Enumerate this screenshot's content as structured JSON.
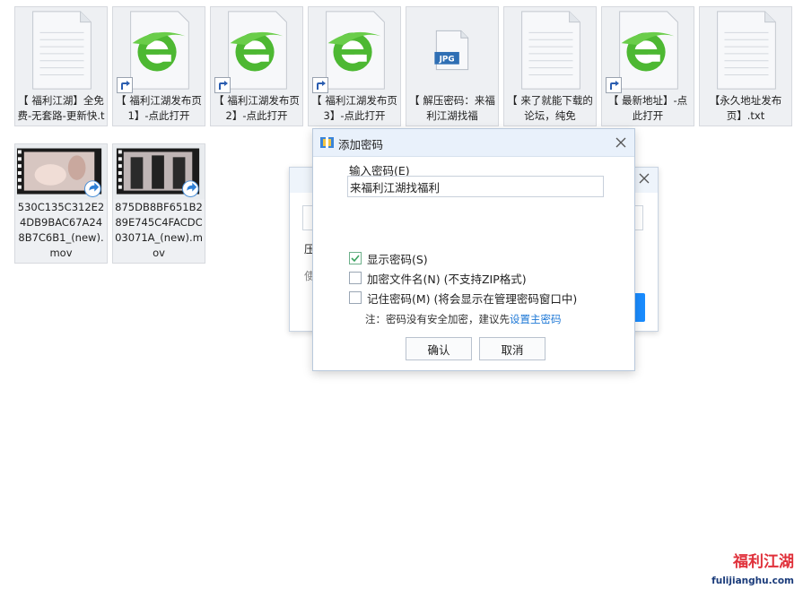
{
  "files": [
    {
      "label": "【 福利江湖】全免费-无套路-更新快.txt",
      "type": "txt",
      "shortcut": false
    },
    {
      "label": "【 福利江湖发布页1】-点此打开",
      "type": "ie",
      "shortcut": true
    },
    {
      "label": "【 福利江湖发布页2】-点此打开",
      "type": "ie",
      "shortcut": true
    },
    {
      "label": "【 福利江湖发布页3】-点此打开",
      "type": "ie",
      "shortcut": true
    },
    {
      "label": "【 解压密码：来福利江湖找福",
      "type": "jpg",
      "shortcut": false,
      "badge": "JPG"
    },
    {
      "label": "【 来了就能下载的论坛，纯免",
      "type": "txt",
      "shortcut": false
    },
    {
      "label": "【 最新地址】-点此打开",
      "type": "ie",
      "shortcut": true
    },
    {
      "label": "【永久地址发布页】.txt",
      "type": "txt",
      "shortcut": false
    }
  ],
  "videos": [
    {
      "label": "530C135C312E24DB9BAC67A248B7C6B1_(new).mov"
    },
    {
      "label": "875DB8BF651B289E745C4FACDC03071A_(new).mov"
    }
  ],
  "background_dialog": {
    "partial_1": "压",
    "partial_2": "使"
  },
  "dialog": {
    "title": "添加密码",
    "field_label": "输入密码(E)",
    "password_value": "来福利江湖找福利",
    "options": [
      {
        "label": "显示密码(S)",
        "checked": true
      },
      {
        "label": "加密文件名(N)  (不支持ZIP格式)",
        "checked": false
      },
      {
        "label": "记住密码(M)  (将会显示在管理密码窗口中)",
        "checked": false
      }
    ],
    "note_text": "注：密码没有安全加密，建议先",
    "note_link": "设置主密码",
    "ok_label": "确认",
    "cancel_label": "取消"
  },
  "watermark": {
    "brand": "福利江湖",
    "domain": "fulijianghu.com"
  },
  "colors": {
    "accent": "#1a8cff",
    "ie_green": "#4db832",
    "link": "#1e78d6"
  }
}
